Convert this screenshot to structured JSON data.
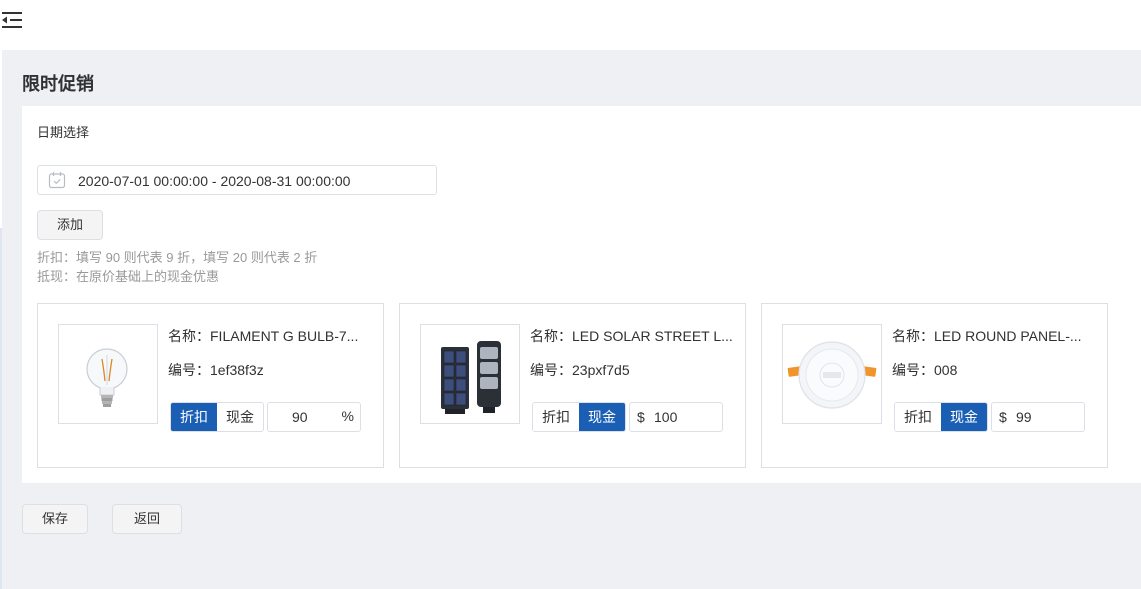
{
  "page": {
    "title": "限时促销"
  },
  "form": {
    "date_label": "日期选择",
    "date_range": "2020-07-01 00:00:00 - 2020-08-31 00:00:00",
    "add_label": "添加",
    "hint_discount": "折扣：填写 90 则代表 9 折，填写 20 则代表 2 折",
    "hint_cash": "抵现：在原价基础上的现金优惠"
  },
  "products": [
    {
      "name": "名称：FILAMENT G BULB-7...",
      "code": "编号：1ef38f3z",
      "mode_discount": "折扣",
      "mode_cash": "现金",
      "active_mode": "discount",
      "currency": "",
      "value": "90",
      "unit": "%",
      "image": "bulb-image"
    },
    {
      "name": "名称：LED SOLAR STREET L...",
      "code": "编号：23pxf7d5",
      "mode_discount": "折扣",
      "mode_cash": "现金",
      "active_mode": "cash",
      "currency": "$",
      "value": "100",
      "unit": "",
      "image": "solar-street-light-image"
    },
    {
      "name": "名称：LED ROUND PANEL-...",
      "code": "编号：008",
      "mode_discount": "折扣",
      "mode_cash": "现金",
      "active_mode": "cash",
      "currency": "$",
      "value": "99",
      "unit": "",
      "image": "round-panel-image"
    }
  ],
  "actions": {
    "save_label": "保存",
    "back_label": "返回"
  },
  "icons": {
    "menu": "menu-fold-icon",
    "calendar": "calendar-icon"
  },
  "colors": {
    "accent": "#1a5fb4",
    "background": "#eff0f4"
  }
}
